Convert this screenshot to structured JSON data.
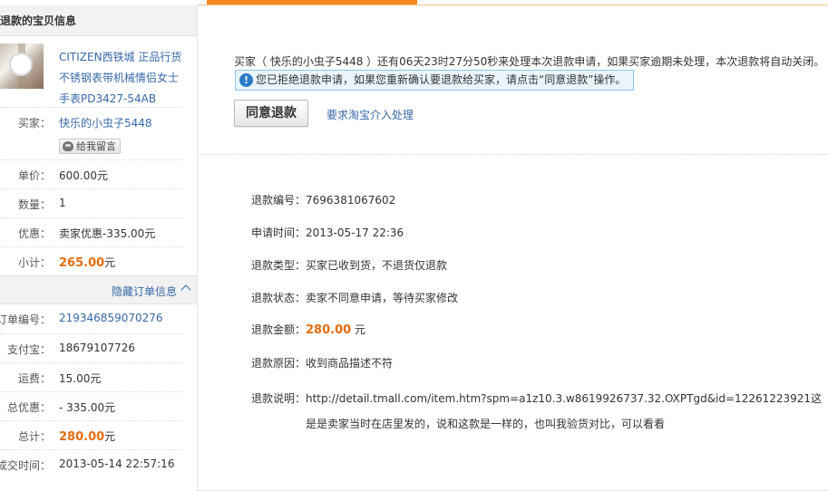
{
  "sidebar": {
    "header": "退款的宝贝信息",
    "product_title": "CITIZEN西铁城 正品行货 不锈钢表带机械情侣女士手表PD3427-54AB",
    "buyer_label": "买家：",
    "buyer_value": "快乐的小虫子5448",
    "message_button": "给我留言",
    "price_label": "单价：",
    "price_value": "600.00元",
    "qty_label": "数量：",
    "qty_value": "1",
    "discount_label": "优惠：",
    "discount_value": "卖家优惠-335.00元",
    "subtotal_label": "小计：",
    "subtotal_amount": "265.00",
    "subtotal_unit": "元",
    "toggle_label": "隐藏订单信息",
    "order_no_label": "订单编号：",
    "order_no_value": "219346859070276",
    "alipay_label": "支付宝：",
    "alipay_value": "18679107726",
    "shipping_label": "运费：",
    "shipping_value": "15.00元",
    "total_discount_label": "总优惠：",
    "total_discount_value": "- 335.00元",
    "total_label": "总计：",
    "total_amount": "280.00",
    "total_unit": "元",
    "deal_time_label": "成交时间：",
    "deal_time_value": "2013-05-14 22:57:16"
  },
  "main": {
    "notice": "买家（ 快乐的小虫子5448 ）还有06天23时27分50秒来处理本次退款申请，如果买家逾期未处理，本次退款将自动关闭。",
    "tip": "您已拒绝退款申请，如果您重新确认要退款给买家，请点击“同意退款”操作。",
    "agree_button": "同意退款",
    "taobao_link": "要求淘宝介入处理",
    "refund_no_label": "退款编号：",
    "refund_no_value": "7696381067602",
    "apply_time_label": "申请时间：",
    "apply_time_value": "2013-05-17 22:36",
    "refund_type_label": "退款类型：",
    "refund_type_value": "买家已收到货，不退货仅退款",
    "refund_status_label": "退款状态：",
    "refund_status_value": "卖家不同意申请，等待买家修改",
    "refund_amount_label": "退款金额：",
    "refund_amount_value": "280.00",
    "refund_amount_unit": "元",
    "refund_reason_label": "退款原因：",
    "refund_reason_value": "收到商品描述不符",
    "refund_desc_label": "退款说明：",
    "refund_desc_value": "http://detail.tmall.com/item.htm?spm=a1z10.3.w8619926737.32.OXPTgd&id=12261223921这是是卖家当时在店里发的，说和这款是一样的，也叫我验货对比，可以看看"
  },
  "colors": {
    "accent_orange": "#f78a1e",
    "amount_orange": "#e46d0e",
    "link_blue": "#3669a9",
    "tip_bg": "#eaf4fd"
  },
  "icons": [
    "info-icon",
    "avatar-icon",
    "chevron-up-icon"
  ]
}
